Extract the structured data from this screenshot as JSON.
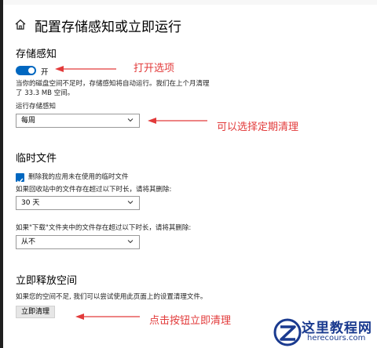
{
  "header": {
    "title": "配置存储感知或立即运行"
  },
  "storage_sense": {
    "heading": "存储感知",
    "toggle_label": "开",
    "toggle_on": true,
    "desc_line1": "当你的磁盘空间不足时，存储感知将自动运行。我们在上个月清理",
    "desc_line2": "了 33.3 MB 空间。",
    "run_label": "运行存储感知",
    "run_value": "每周"
  },
  "temp_files": {
    "heading": "临时文件",
    "checkbox_label": "删除我的应用未在使用的临时文件",
    "checkbox_checked": true,
    "recycle_label": "如果回收站中的文件存在超过以下时长，请将其删除:",
    "recycle_value": "30 天",
    "downloads_label": "如果\"下载\"文件夹中的文件存在超过以下时长，请将其删除:",
    "downloads_value": "从不"
  },
  "free_now": {
    "heading": "立即释放空间",
    "desc": "如果您的空间不足, 我们可以尝试使用此页面上的设置清理文件。",
    "button_label": "立即清理"
  },
  "annotations": {
    "toggle_note": "打开选项",
    "schedule_note": "可以选择定期清理",
    "button_note": "点击按钮立即清理",
    "color": "#e23a3a"
  },
  "watermark": {
    "title": "这里教程网",
    "url": "herecours.com"
  },
  "colors": {
    "accent": "#0067c0"
  }
}
